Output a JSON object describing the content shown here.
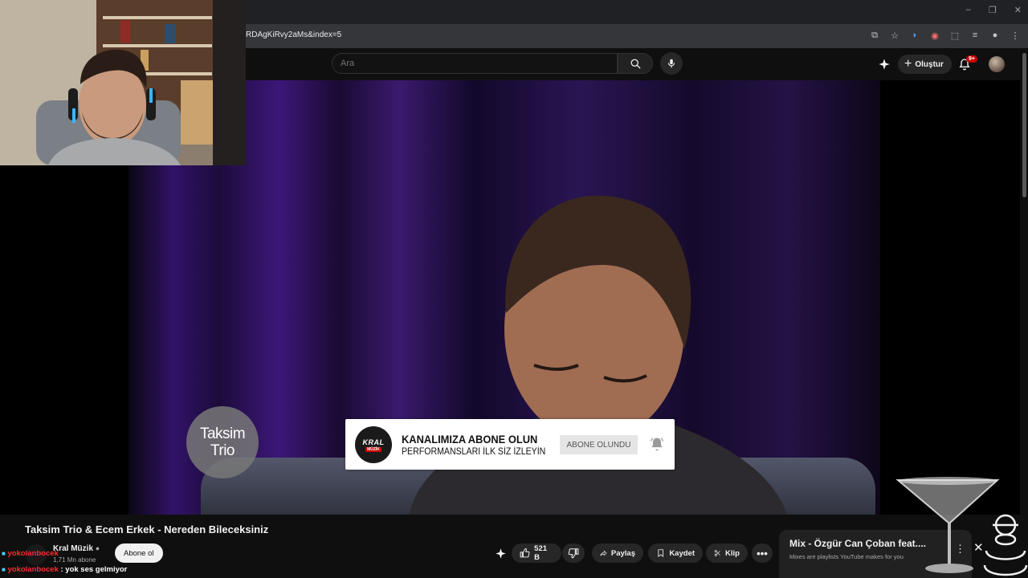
{
  "browser": {
    "url_fragment": "RDAgKiRvy2aMs&index=5",
    "window_controls": [
      "–",
      "❐",
      "✕"
    ]
  },
  "header": {
    "search_placeholder": "Ara",
    "create_label": "Oluştur",
    "notifications_badge": "9+"
  },
  "video": {
    "logo_line1": "Taksim",
    "logo_line2": "Trio",
    "banner_title": "KANALIMIZA ABONE OLUN",
    "banner_subtitle": "PERFORMANSLARI İLK SİZ İZLEYİN",
    "banner_button": "ABONE OLUNDU",
    "banner_logo_top": "KRAL",
    "banner_logo_bottom": "MÜZİK"
  },
  "below": {
    "title": "Taksim Trio & Ecem Erkek - Nereden Bileceksiniz",
    "channel_name": "Kral Müzik",
    "channel_subs": "1,71 Mn abone",
    "subscribe_label": "Abone ol",
    "likes": "521 B",
    "share_label": "Paylaş",
    "save_label": "Kaydet",
    "clip_label": "Klip"
  },
  "chat": [
    {
      "user": "yokolanbocek",
      "message": ""
    },
    {
      "user": "yokolanbocek",
      "message": ": yok ses gelmiyor"
    }
  ],
  "mix": {
    "title": "Mix - Özgür Can Çoban feat....",
    "subtitle": "Mixes are playlists YouTube makes for you"
  },
  "colors": {
    "background": "#0f0f0f",
    "chat_user": "#ff2b2b",
    "notification_badge": "#cc0000"
  }
}
